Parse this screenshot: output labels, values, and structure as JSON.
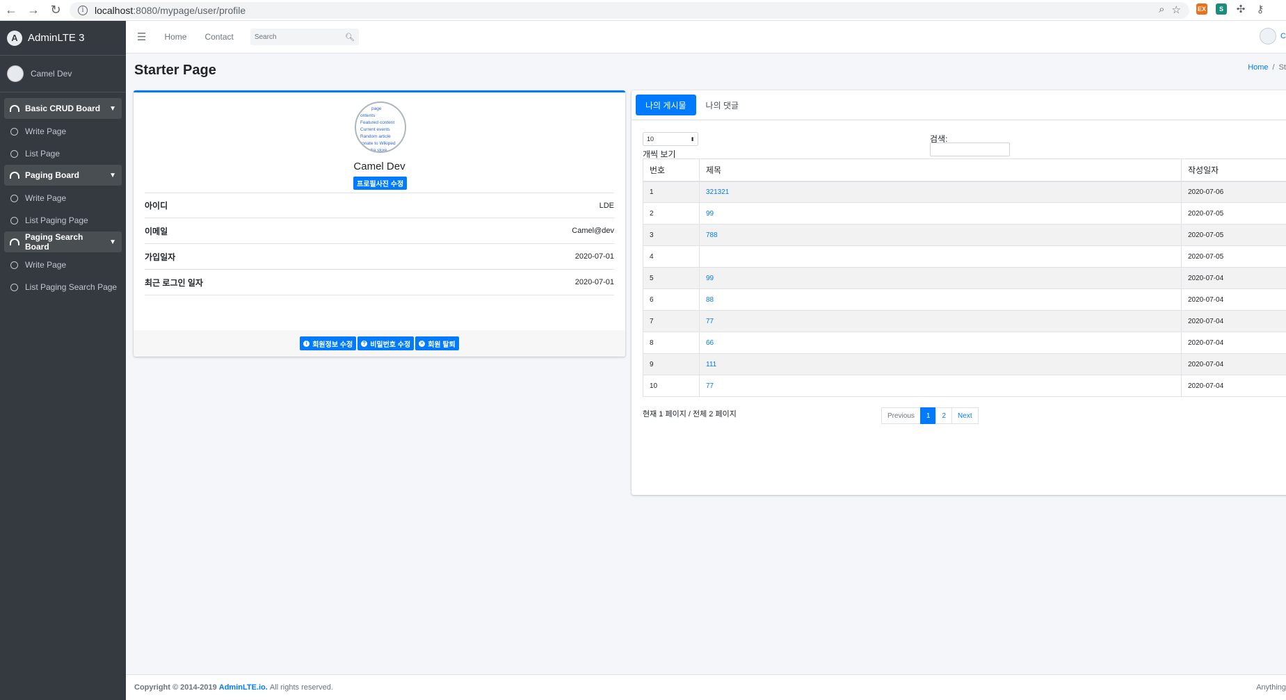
{
  "browser": {
    "url_host": "localhost",
    "url_path": ":8080/mypage/user/profile"
  },
  "sidebar": {
    "brand": "AdminLTE 3",
    "brand_logo_letter": "A",
    "user_name": "Camel Dev",
    "groups": [
      {
        "label": "Basic CRUD Board",
        "items": [
          "Write Page",
          "List Page"
        ]
      },
      {
        "label": "Paging Board",
        "items": [
          "Write Page",
          "List Paging Page"
        ]
      },
      {
        "label": "Paging Search Board",
        "items": [
          "Write Page",
          "List Paging Search Page"
        ]
      }
    ]
  },
  "topnav": {
    "links": [
      "Home",
      "Contact"
    ],
    "search_placeholder": "Search",
    "user_initial": "C"
  },
  "page": {
    "title": "Starter Page",
    "breadcrumb_home": "Home",
    "breadcrumb_sep": "/",
    "breadcrumb_current": "St"
  },
  "profile": {
    "picture_lines": [
      "page",
      "ontents",
      "Featured content",
      "Current events",
      "Random article",
      "ronate to Wikiped",
      "edia store"
    ],
    "name": "Camel Dev",
    "edit_photo": "프로필사진 수정",
    "rows": [
      {
        "key": "아이디",
        "value": "LDE"
      },
      {
        "key": "이메일",
        "value": "Camel@dev"
      },
      {
        "key": "가입일자",
        "value": "2020-07-01"
      },
      {
        "key": "최근 로그인 일자",
        "value": "2020-07-01"
      }
    ],
    "buttons": [
      "회원정보 수정",
      "비밀번호 수정",
      "회원 탈퇴"
    ]
  },
  "posts": {
    "tabs": [
      "나의 게시물",
      "나의 댓글"
    ],
    "length_value": "10",
    "length_label": "개씩 보기",
    "search_label": "검색:",
    "columns": [
      "번호",
      "제목",
      "작성일자"
    ],
    "rows": [
      {
        "no": "1",
        "title": "321321",
        "date": "2020-07-06"
      },
      {
        "no": "2",
        "title": "99",
        "date": "2020-07-05"
      },
      {
        "no": "3",
        "title": "788",
        "date": "2020-07-05"
      },
      {
        "no": "4",
        "title": "",
        "date": "2020-07-05"
      },
      {
        "no": "5",
        "title": "99",
        "date": "2020-07-04"
      },
      {
        "no": "6",
        "title": "88",
        "date": "2020-07-04"
      },
      {
        "no": "7",
        "title": "77",
        "date": "2020-07-04"
      },
      {
        "no": "8",
        "title": "66",
        "date": "2020-07-04"
      },
      {
        "no": "9",
        "title": "111",
        "date": "2020-07-04"
      },
      {
        "no": "10",
        "title": "77",
        "date": "2020-07-04"
      }
    ],
    "page_info": "현재 1 페이지 / 전체 2 페이지",
    "pager": {
      "prev": "Previous",
      "pages": [
        "1",
        "2"
      ],
      "next": "Next"
    }
  },
  "footer": {
    "copyright": "Copyright © 2014-2019",
    "brand_link": "AdminLTE.io.",
    "rest": "All rights reserved.",
    "right": "Anything"
  },
  "colors": {
    "primary": "#007bff",
    "sidebar_bg": "#343a40"
  }
}
